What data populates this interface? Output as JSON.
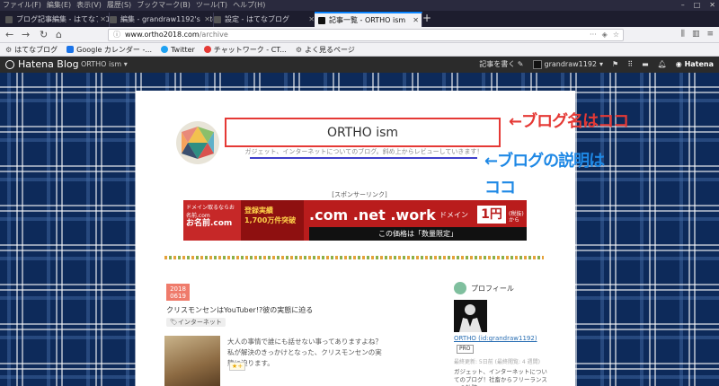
{
  "titlebar": {
    "menus": [
      "ファイル(F)",
      "編集(E)",
      "表示(V)",
      "履歴(S)",
      "ブックマーク(B)",
      "ツール(T)",
      "ヘルプ(H)"
    ]
  },
  "tabs": [
    {
      "label": "ブログ記事編集 - はてなブロ",
      "active": false
    },
    {
      "label": "編集 - grandraw1192's fotol",
      "active": false
    },
    {
      "label": "設定 - はてなブログ",
      "active": false
    },
    {
      "label": "記事一覧 - ORTHO ism",
      "active": true
    }
  ],
  "url": {
    "host": "www.ortho2018.com",
    "path": "/archive"
  },
  "bookmarks": [
    {
      "label": "はてなブログ",
      "color": "#333333"
    },
    {
      "label": "Google カレンダー -...",
      "color": "#1a73e8"
    },
    {
      "label": "Twitter",
      "color": "#1da1f2"
    },
    {
      "label": "チャットワーク - CT...",
      "color": "#e53935"
    },
    {
      "label": "よく見るページ",
      "color": "#888888"
    }
  ],
  "hatena": {
    "logo": "Hatena Blog",
    "blog_select": "ORTHO ism",
    "write_label": "記事を書く",
    "user": "grandraw1192",
    "brand": "Hatena"
  },
  "blog": {
    "title": "ORTHO ism",
    "description": "ガジェット、インターネットについてのブログ。斜め上からレビューしていきます！"
  },
  "annotations": {
    "title_note": "←ブログ名はココ",
    "desc_note_line1": "←ブログの説明は",
    "desc_note_line2": "ココ"
  },
  "sponsor": "[スポンサーリンク]",
  "ad": {
    "brand_small": "ドメイン取るならお名前.com",
    "brand_big": "お名前.com",
    "record_label": "登録実績",
    "record_value": "1,700万件突破",
    "domains": ".com .net .work",
    "domain_tag": "ドメイン",
    "price": "1円",
    "price_suffix": "(税抜)から",
    "bottom": "この価格は「数量限定」"
  },
  "article": {
    "year": "2018",
    "date": "0619",
    "title": "クリスモンセンはYouTuber!?彼の実態に迫る",
    "tag": "インターネット",
    "excerpt": "大人の事情で誰にも話せない事ってありますよね？私が解決のきっかけとなった、クリスモンセンの実態に迫ります。",
    "star": "★+"
  },
  "profile": {
    "heading": "プロフィール",
    "name": "ORTHO (id:grandraw1192)",
    "badge": "PRO",
    "updated": "最終更新: 5日前 (最終閲覧: 4 週間)",
    "text": "ガジェット、インターネットについてのブログ！社畜からフリーランスへの軌跡"
  },
  "colors": {
    "accent_red": "#e53935",
    "accent_blue": "#1e88e5",
    "date_badge": "#ef7b6b",
    "plaid_base": "#0d2a5a"
  }
}
